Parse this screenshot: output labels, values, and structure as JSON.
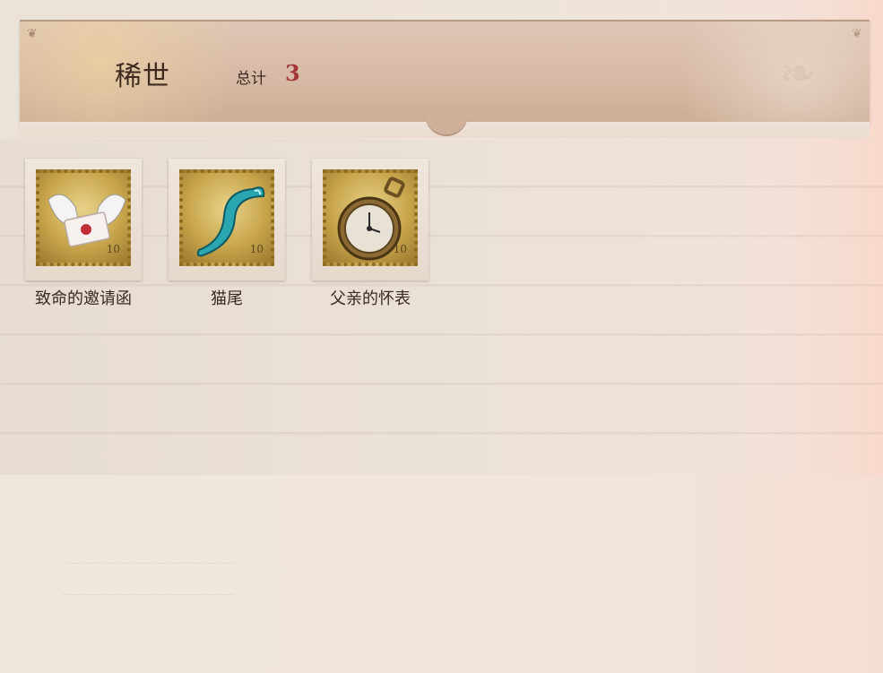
{
  "header": {
    "title": "稀世",
    "total_label": "总计",
    "total_value": "3"
  },
  "items": [
    {
      "label": "致命的邀请函",
      "icon": "winged-letter-icon",
      "stamp_value": "10"
    },
    {
      "label": "猫尾",
      "icon": "cat-tail-icon",
      "stamp_value": "10"
    },
    {
      "label": "父亲的怀表",
      "icon": "pocket-watch-icon",
      "stamp_value": "10"
    }
  ],
  "colors": {
    "accent_red": "#a4353a",
    "banner": "#d6b9a4",
    "stamp_gold": "#c9a64d"
  }
}
